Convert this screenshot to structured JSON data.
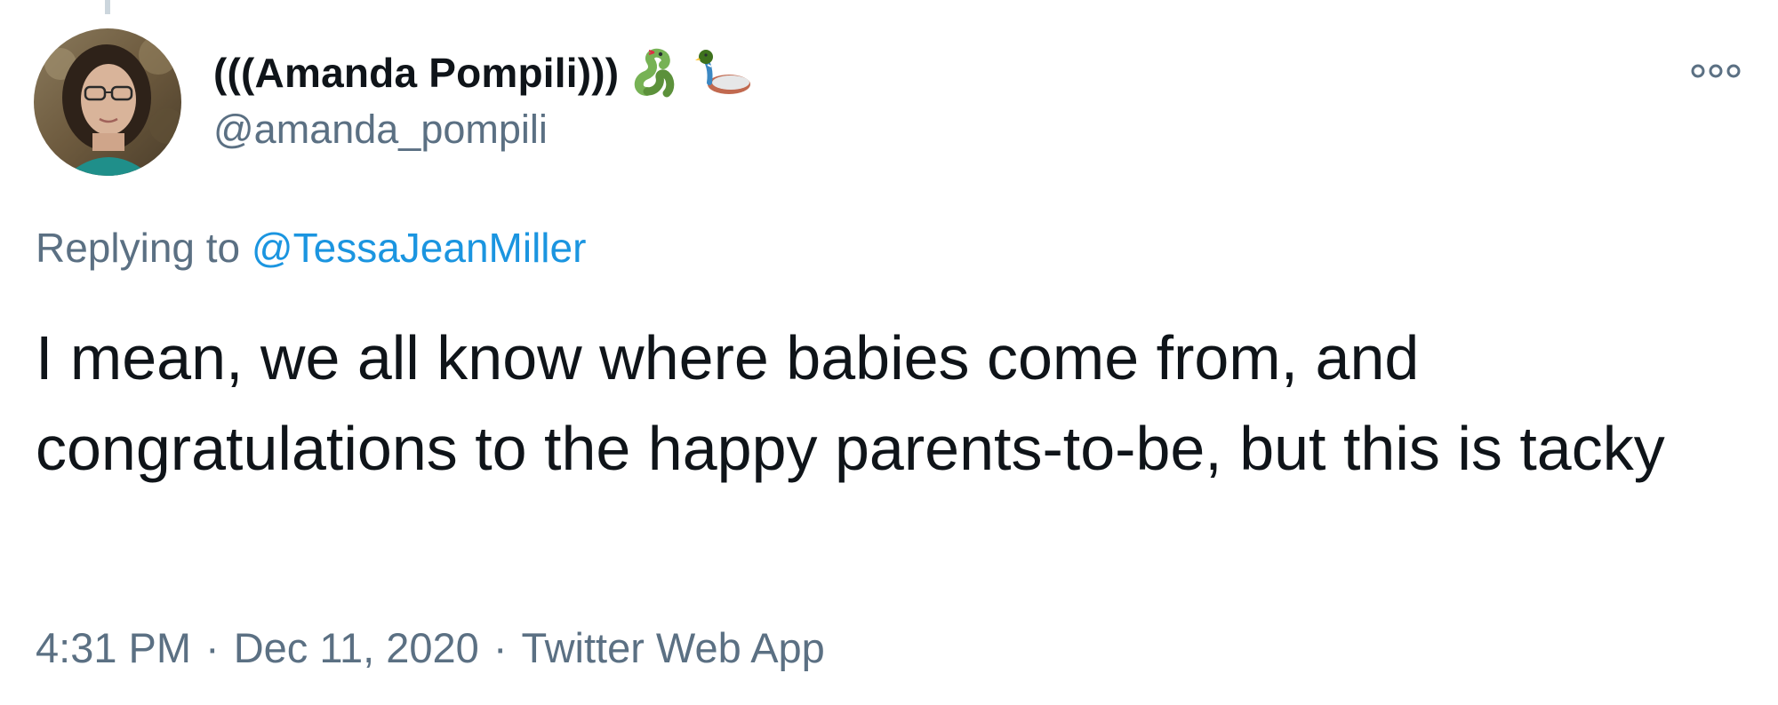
{
  "tweet": {
    "author": {
      "display_name": "(((Amanda Pompili)))",
      "handle": "@amanda_pompili",
      "name_emojis": [
        "snake-emoji",
        "duck-emoji"
      ]
    },
    "more_icon": "more-horizontal-icon",
    "reply_prefix": "Replying to ",
    "reply_to": "@TessaJeanMiller",
    "text": "I mean, we all know where babies come from, and congratulations to the happy parents-to-be, but this is tacky",
    "time": "4:31 PM",
    "separator": "·",
    "date": "Dec 11, 2020",
    "source": "Twitter Web App"
  },
  "colors": {
    "text_primary": "#0f1419",
    "text_secondary": "#5b7083",
    "link": "#1b95e0",
    "thread_line": "#ccd6dd"
  }
}
